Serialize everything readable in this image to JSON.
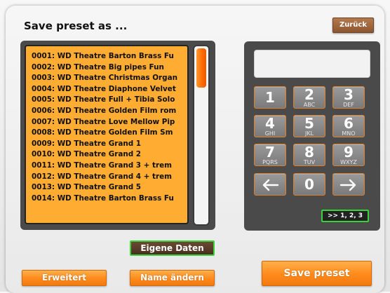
{
  "header": {
    "title": "Save preset as ...",
    "back_label": "Zurück"
  },
  "preset_list": {
    "items": [
      "0001: WD Theatre Barton Brass Fu",
      "0002: WD Theatre Big pipes Fun",
      "0003: WD Theatre Christmas Organ",
      "0004: WD Theatre Diaphone Velvet",
      "0005: WD Theatre Full + Tibia Solo",
      "0006: WD Theatre Golden Film rom",
      "0007: WD Theatre Love Mellow Pip",
      "0008: WD Theatre Golden Film Sm",
      "0009: WD Theatre Grand 1",
      "0010: WD Theatre Grand 2",
      "0011: WD Theatre Grand 3 + trem",
      "0012: WD Theatre Grand 4 + trem",
      "0013: WD Theatre Grand 5",
      "0014: WD Theatre Barton Brass Fu"
    ]
  },
  "keypad": {
    "display_value": "",
    "keys": [
      {
        "num": "1",
        "sub": ""
      },
      {
        "num": "2",
        "sub": "ABC"
      },
      {
        "num": "3",
        "sub": "DEF"
      },
      {
        "num": "4",
        "sub": "GHI"
      },
      {
        "num": "5",
        "sub": "JKL"
      },
      {
        "num": "6",
        "sub": "MNO"
      },
      {
        "num": "7",
        "sub": "PQRS"
      },
      {
        "num": "8",
        "sub": "TUV"
      },
      {
        "num": "9",
        "sub": "WXYZ"
      }
    ],
    "zero": "0",
    "left_icon": "arrow-left-icon",
    "right_icon": "arrow-right-icon",
    "shift_label": ">> 1, 2, 3"
  },
  "buttons": {
    "own_data": "Eigene Daten",
    "extended": "Erweitert",
    "rename": "Name ändern",
    "save": "Save preset"
  },
  "colors": {
    "accent_orange": "#ff8a1c",
    "list_background": "#ffac32",
    "panel_dark": "#4a4a4a",
    "selection_green": "#3ad23a"
  }
}
